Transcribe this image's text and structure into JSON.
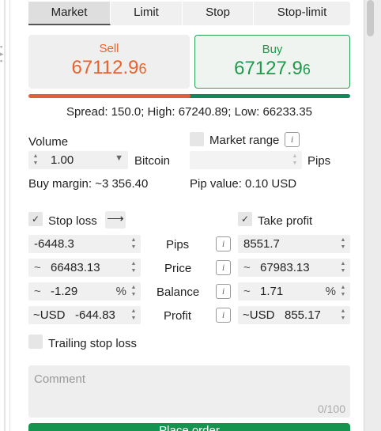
{
  "tabs": [
    {
      "label": "Market",
      "active": true
    },
    {
      "label": "Limit",
      "active": false
    },
    {
      "label": "Stop",
      "active": false
    },
    {
      "label": "Stop-limit",
      "active": false
    }
  ],
  "sell": {
    "label": "Sell",
    "price_main": "67112.9",
    "price_pip": "6"
  },
  "buy": {
    "label": "Buy",
    "price_main": "67127.9",
    "price_pip": "6"
  },
  "spread_text": "Spread: 150.0; High: 67240.89; Low: 66233.35",
  "volume": {
    "label": "Volume",
    "value": "1.00",
    "unit": "Bitcoin",
    "buy_margin": "Buy margin: ~3 356.40"
  },
  "market_range": {
    "label": "Market range",
    "unit": "Pips",
    "pip_value": "Pip value: 0.10 USD"
  },
  "stop_loss": {
    "label": "Stop loss",
    "checked": true,
    "pips": "-6448.3",
    "price": "66483.13",
    "balance": "-1.29",
    "profit_currency": "~USD",
    "profit": "-644.83"
  },
  "take_profit": {
    "label": "Take profit",
    "checked": true,
    "pips": "8551.7",
    "price": "67983.13",
    "balance": "1.71",
    "profit_currency": "~USD",
    "profit": "855.17"
  },
  "rows": {
    "pips": "Pips",
    "price": "Price",
    "balance": "Balance",
    "profit": "Profit"
  },
  "symbols": {
    "tilde": "~",
    "percent": "%",
    "info": "i",
    "check": "✓",
    "arrow": "⟶"
  },
  "trailing_stop": {
    "label": "Trailing stop loss"
  },
  "comment": {
    "placeholder": "Comment",
    "counter": "0/100"
  },
  "place_order": {
    "label": "Place order"
  },
  "colors": {
    "sell": "#e8622a",
    "buy": "#1f9a4c",
    "place_order": "#159450"
  }
}
